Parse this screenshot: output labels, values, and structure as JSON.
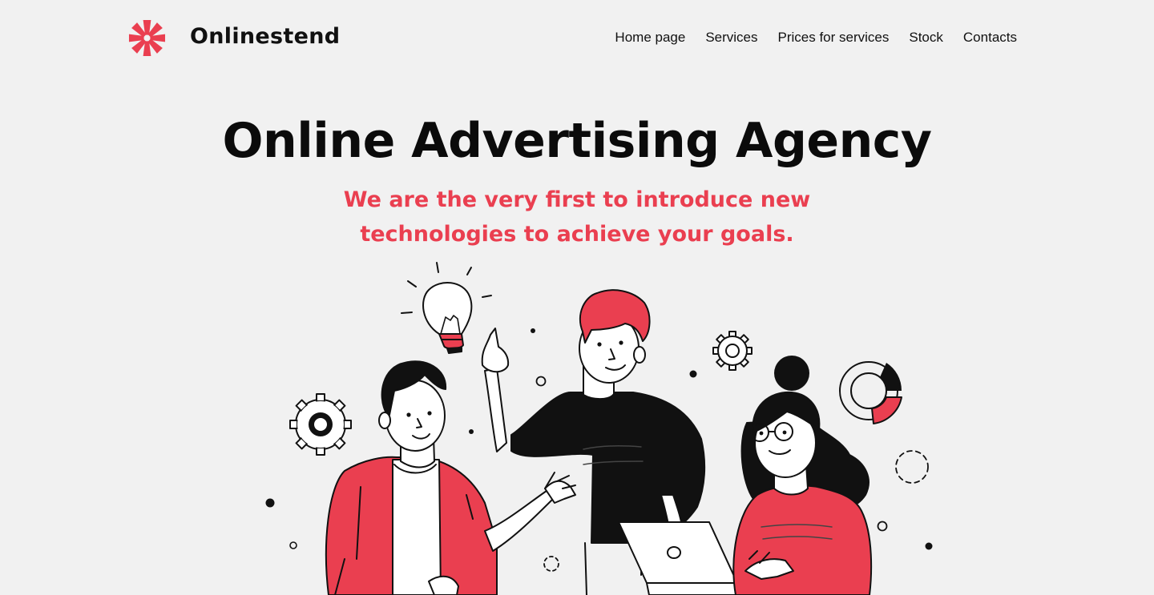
{
  "header": {
    "brand_name": "Onlinestend",
    "logo_icon": "starburst-logo-icon",
    "nav": [
      {
        "label": "Home page"
      },
      {
        "label": "Services"
      },
      {
        "label": "Prices for services"
      },
      {
        "label": "Stock"
      },
      {
        "label": "Contacts"
      }
    ]
  },
  "hero": {
    "title": "Online Advertising Agency",
    "subtitle": "We are the very first to introduce new technologies to achieve your goals."
  },
  "illustration": {
    "icons": [
      "lightbulb-icon",
      "gear-icon",
      "donut-chart-icon",
      "laptop-icon"
    ]
  },
  "colors": {
    "accent": "#ea3f50",
    "background": "#f1f1f1",
    "text": "#111111"
  }
}
